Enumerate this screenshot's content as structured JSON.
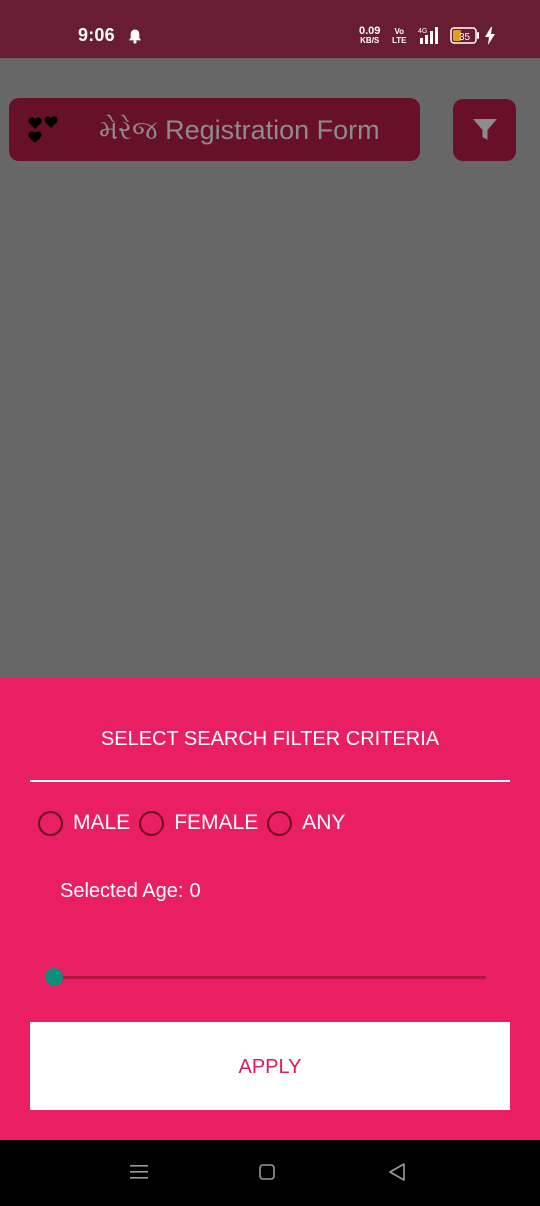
{
  "status_bar": {
    "time": "9:06",
    "net_speed": "0.09",
    "net_unit": "KB/S",
    "volte_top": "Vo",
    "volte_bottom": "LTE",
    "network_type": "4G",
    "battery": "35",
    "icons": [
      "bell-icon",
      "signal-icon",
      "battery-icon",
      "charging-icon"
    ]
  },
  "header": {
    "title": "મેરેજ Registration Form",
    "logo_icon": "hearts-icon",
    "filter_icon": "filter-icon"
  },
  "sheet": {
    "title": "SELECT SEARCH FILTER CRITERIA",
    "gender_options": [
      "MALE",
      "FEMALE",
      "ANY"
    ],
    "age_label": "Selected Age:",
    "age_value": "0",
    "slider_fraction": 0,
    "apply_label": "APPLY"
  },
  "navbar": {
    "icons": [
      "menu-icon",
      "home-icon",
      "back-icon"
    ]
  },
  "colors": {
    "status_bar": "#681d33",
    "scrim": "#676767",
    "header_bg": "#681028",
    "sheet_bg": "#e91e63",
    "slider_thumb": "#0e8c7c",
    "apply_text": "#e0195a"
  }
}
